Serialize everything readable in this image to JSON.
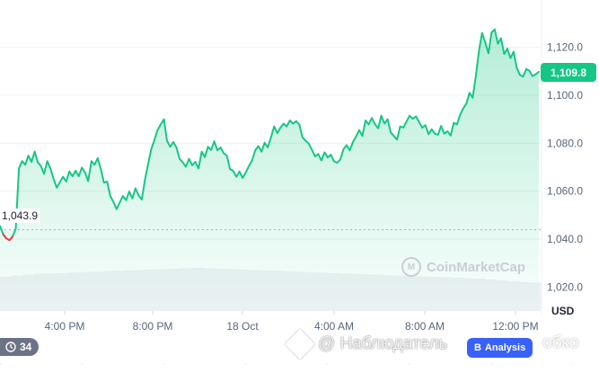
{
  "chart_data": {
    "type": "area",
    "x_ticks": [
      "4:00 PM",
      "8:00 PM",
      "18 Oct",
      "4:00 AM",
      "8:00 AM",
      "12:00 PM"
    ],
    "y_ticks": [
      1020.0,
      1040.0,
      1060.0,
      1080.0,
      1100.0,
      1120.0
    ],
    "y_tick_labels": [
      "1,020.0",
      "1,040.0",
      "1,060.0",
      "1,080.0",
      "1,100.0",
      "1,120.0"
    ],
    "ylim": [
      1010,
      1136
    ],
    "reference_price": 1043.9,
    "reference_label": "1,043.9",
    "current_price": 1109.8,
    "current_label": "1,109.8",
    "unit": "USD",
    "series": [
      {
        "values": [
          1045.5,
          1042.0,
          1040.3,
          1039.5,
          1041.0,
          1044.2,
          1069.5,
          1072.5,
          1071.0,
          1074.8,
          1072.2,
          1076.5,
          1072.0,
          1070.5,
          1067.2,
          1072.5,
          1069.5,
          1065.2,
          1061.5,
          1063.8,
          1066.0,
          1064.0,
          1068.2,
          1066.2,
          1068.5,
          1066.2,
          1069.8,
          1067.8,
          1064.2,
          1072.5,
          1071.0,
          1073.8,
          1069.2,
          1063.5,
          1064.0,
          1058.0,
          1055.5,
          1052.5,
          1055.2,
          1058.0,
          1056.2,
          1059.8,
          1057.0,
          1061.2,
          1058.2,
          1056.5,
          1064.8,
          1071.2,
          1077.5,
          1081.2,
          1085.5,
          1087.8,
          1090.0,
          1081.0,
          1078.5,
          1080.5,
          1078.2,
          1073.5,
          1072.0,
          1070.2,
          1073.5,
          1070.8,
          1072.2,
          1069.5,
          1076.5,
          1074.2,
          1078.5,
          1077.2,
          1080.8,
          1077.0,
          1078.2,
          1075.8,
          1074.8,
          1069.2,
          1068.5,
          1066.0,
          1068.2,
          1065.5,
          1067.8,
          1070.5,
          1072.8,
          1077.0,
          1078.8,
          1076.5,
          1080.2,
          1078.2,
          1082.5,
          1087.0,
          1084.2,
          1086.5,
          1088.2,
          1087.0,
          1089.5,
          1088.2,
          1089.2,
          1087.8,
          1082.5,
          1081.0,
          1079.8,
          1077.2,
          1074.5,
          1075.5,
          1072.8,
          1076.2,
          1074.0,
          1075.2,
          1072.5,
          1071.8,
          1073.2,
          1077.5,
          1079.2,
          1077.0,
          1080.5,
          1082.8,
          1085.5,
          1083.0,
          1089.5,
          1087.8,
          1090.5,
          1088.0,
          1086.2,
          1091.5,
          1088.2,
          1090.0,
          1084.5,
          1083.0,
          1081.5,
          1087.0,
          1086.5,
          1089.0,
          1091.5,
          1090.2,
          1091.2,
          1088.8,
          1086.5,
          1087.5,
          1083.8,
          1085.8,
          1084.0,
          1083.5,
          1087.2,
          1084.0,
          1085.0,
          1083.2,
          1088.5,
          1087.8,
          1091.8,
          1094.5,
          1096.5,
          1101.0,
          1099.0,
          1107.8,
          1118.5,
          1126.0,
          1122.0,
          1117.5,
          1126.2,
          1127.5,
          1121.5,
          1123.8,
          1117.2,
          1119.5,
          1115.5,
          1118.2,
          1111.5,
          1108.5,
          1107.8,
          1111.0,
          1110.2,
          1108.0,
          1108.8,
          1109.8
        ]
      }
    ],
    "volume": [
      0.8,
      0.82,
      0.84,
      0.86,
      0.87,
      0.88,
      0.89,
      0.9,
      0.91,
      0.92,
      0.93,
      0.94,
      0.95,
      0.96,
      0.97,
      0.98,
      0.99,
      1.0,
      0.99,
      0.98,
      0.97,
      0.96,
      0.95,
      0.94,
      0.93,
      0.92,
      0.91,
      0.9,
      0.89,
      0.88,
      0.87,
      0.86,
      0.85,
      0.84,
      0.83,
      0.82,
      0.81,
      0.8,
      0.79,
      0.78,
      0.77,
      0.76,
      0.75,
      0.73,
      0.71,
      0.69,
      0.67,
      0.66
    ],
    "colors": {
      "line": "#16c784",
      "fill_top": "#16c784",
      "below_line": "#ea3943",
      "reference_line": "#a6b0c3",
      "current_label_bg": "#16c784",
      "volume": "#eff2f5"
    }
  },
  "watermark": "CoinMarketCap",
  "bottom_badge": {
    "icon": "clock-icon",
    "label": "34"
  },
  "overlay": {
    "text": "@ Наблюдатель",
    "text_tail": "обко",
    "button": "Analysis",
    "button_prefix": "B"
  }
}
